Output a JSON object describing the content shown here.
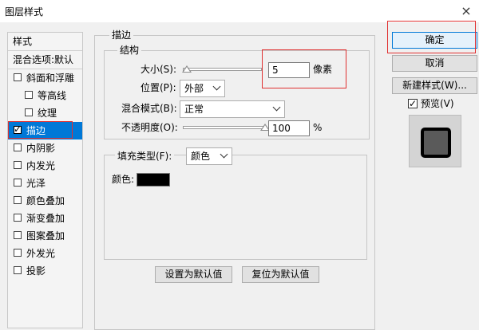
{
  "window": {
    "title": "图层样式",
    "close_glyph": "×"
  },
  "style_list": {
    "header": "样式",
    "blend_options": "混合选项:默认",
    "items": [
      {
        "label": "斜面和浮雕",
        "checked": false
      },
      {
        "label": "等高线",
        "checked": false
      },
      {
        "label": "纹理",
        "checked": false
      },
      {
        "label": "描边",
        "checked": true,
        "selected": true
      },
      {
        "label": "内阴影",
        "checked": false
      },
      {
        "label": "内发光",
        "checked": false
      },
      {
        "label": "光泽",
        "checked": false
      },
      {
        "label": "颜色叠加",
        "checked": false
      },
      {
        "label": "渐变叠加",
        "checked": false
      },
      {
        "label": "图案叠加",
        "checked": false
      },
      {
        "label": "外发光",
        "checked": false
      },
      {
        "label": "投影",
        "checked": false
      }
    ]
  },
  "stroke": {
    "title": "描边",
    "structure_title": "结构",
    "size_label": "大小(S):",
    "size_value": "5",
    "size_unit": "像素",
    "size_slider_fraction": 0.0,
    "position_label": "位置(P):",
    "position_value": "外部",
    "blend_label": "混合模式(B):",
    "blend_value": "正常",
    "opacity_label": "不透明度(O):",
    "opacity_value": "100",
    "opacity_unit": "%",
    "opacity_slider_fraction": 1.0,
    "fill_type_label": "填充类型(F):",
    "fill_type_value": "颜色",
    "color_label": "颜色:",
    "color_hex": "#000000",
    "make_default": "设置为默认值",
    "reset_default": "复位为默认值"
  },
  "buttons": {
    "ok": "确定",
    "cancel": "取消",
    "new_style": "新建样式(W)...",
    "preview_label": "预览(V)",
    "preview_checked": true
  },
  "colors": {
    "accent": "#0078d7",
    "highlight_border": "#e03030"
  }
}
